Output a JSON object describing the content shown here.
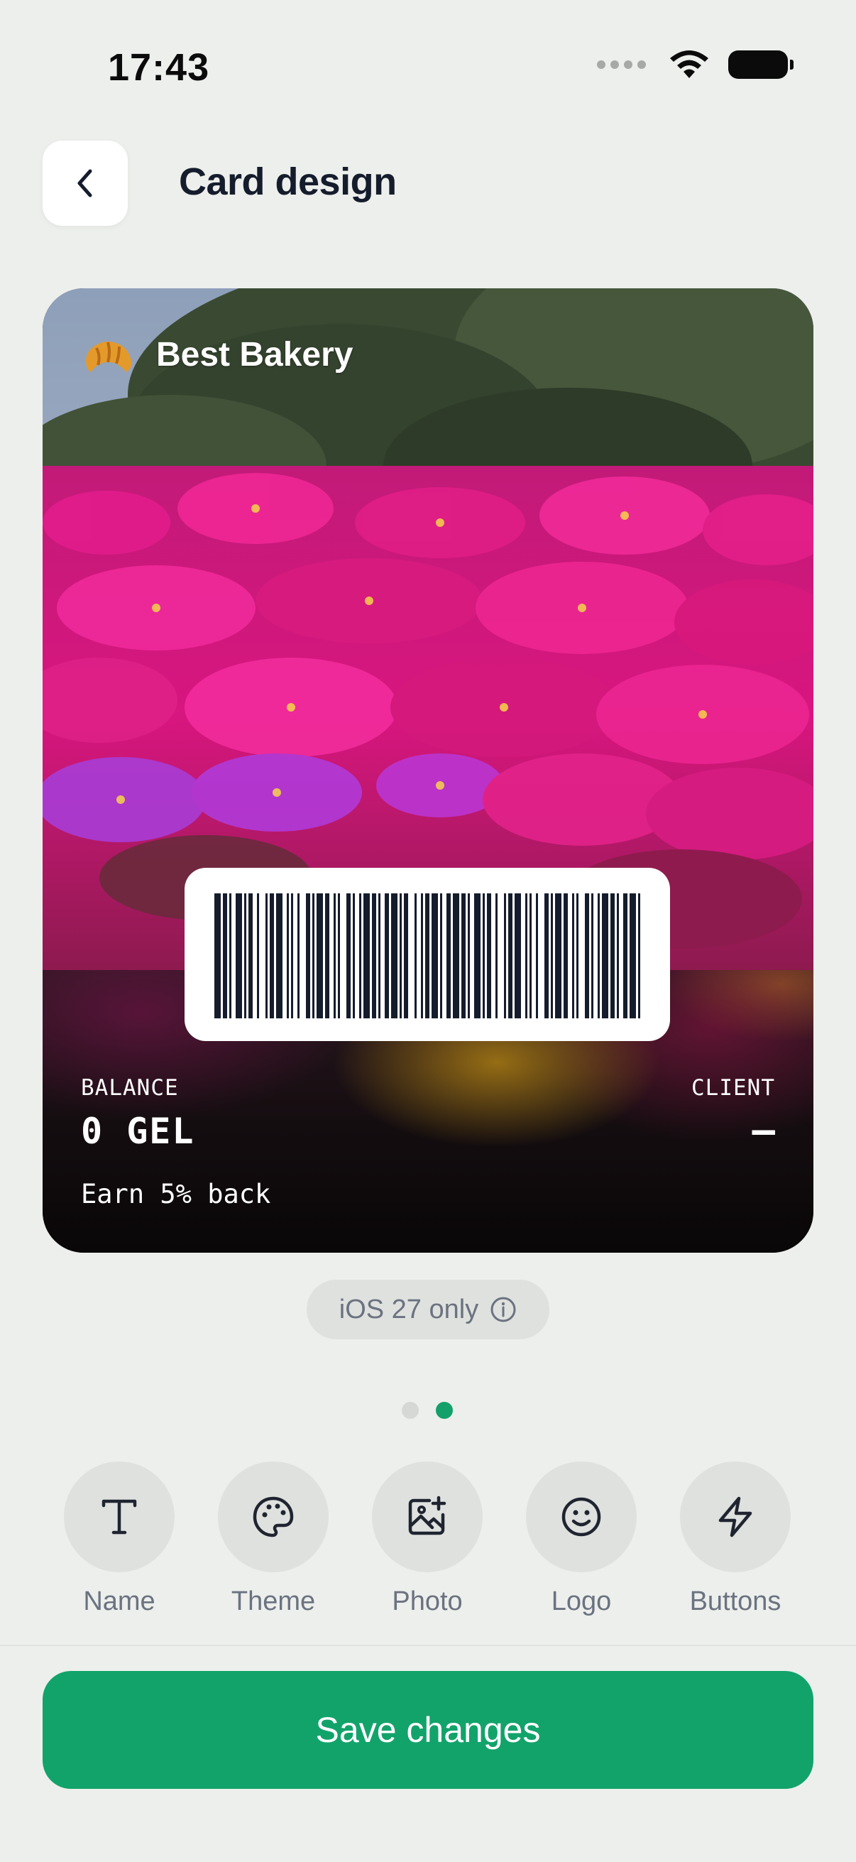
{
  "status_bar": {
    "time": "17:43"
  },
  "header": {
    "title": "Card design"
  },
  "card": {
    "business_name": "Best Bakery",
    "logo_icon": "croissant-icon",
    "balance_label": "BALANCE",
    "balance_value": "0 GEL",
    "client_label": "CLIENT",
    "client_value": "—",
    "earn_text": "Earn 5% back"
  },
  "notice": {
    "text": "iOS 27 only",
    "icon": "info-icon"
  },
  "pager": {
    "total": 2,
    "active": 2
  },
  "tools": [
    {
      "label": "Name",
      "icon": "text-icon"
    },
    {
      "label": "Theme",
      "icon": "palette-icon"
    },
    {
      "label": "Photo",
      "icon": "image-add-icon"
    },
    {
      "label": "Logo",
      "icon": "smiley-icon"
    },
    {
      "label": "Buttons",
      "icon": "lightning-icon"
    }
  ],
  "footer": {
    "save_label": "Save changes"
  },
  "colors": {
    "accent": "#12a36b",
    "background": "#edefec",
    "title": "#151c2c"
  }
}
